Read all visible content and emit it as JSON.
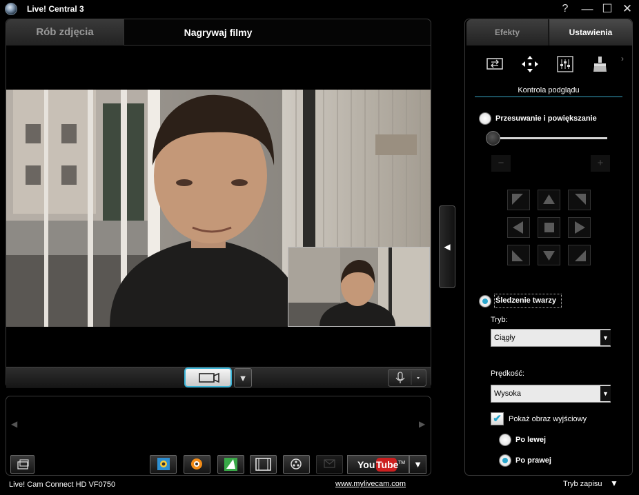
{
  "window": {
    "title": "Live! Central 3",
    "help": "?",
    "minimize": "—",
    "maximize": "☐",
    "close": "✕"
  },
  "left_tabs": [
    {
      "label": "Rób zdjęcia"
    },
    {
      "label": "Nagrywaj filmy"
    }
  ],
  "collapse_arrow": "◀",
  "record_dropdown": "▼",
  "gallery": {
    "prev": "◀",
    "next": "▶"
  },
  "toolbar": {
    "youtube_you": "You",
    "youtube_tube": "Tube",
    "youtube_tm": "TM",
    "dropdown": "▼"
  },
  "status": {
    "device": "Live! Cam Connect HD VF0750",
    "link": "www.mylivecam.com",
    "mode": "Tryb zapisu",
    "mode_arrow": "▼"
  },
  "right_tabs": [
    {
      "label": "Efekty"
    },
    {
      "label": "Ustawienia"
    }
  ],
  "settings": {
    "section_title": "Kontrola podglądu",
    "more": "›",
    "pan_zoom": {
      "label": "Przesuwanie i powiększanie",
      "selected": false,
      "zoom_level": 0,
      "minus": "−",
      "plus": "+"
    },
    "face_tracking": {
      "label": "Śledzenie twarzy",
      "selected": true
    },
    "mode": {
      "label": "Tryb:",
      "value": "Ciągły"
    },
    "speed": {
      "label": "Prędkość:",
      "value": "Wysoka"
    },
    "show_output": {
      "label": "Pokaż obraz wyjściowy",
      "checked": true
    },
    "position": {
      "left": "Po lewej",
      "right": "Po prawej",
      "selected": "right"
    }
  },
  "colors": {
    "accent": "#2aa6cc",
    "background": "#000000",
    "youtube_red": "#cc1f1f"
  }
}
